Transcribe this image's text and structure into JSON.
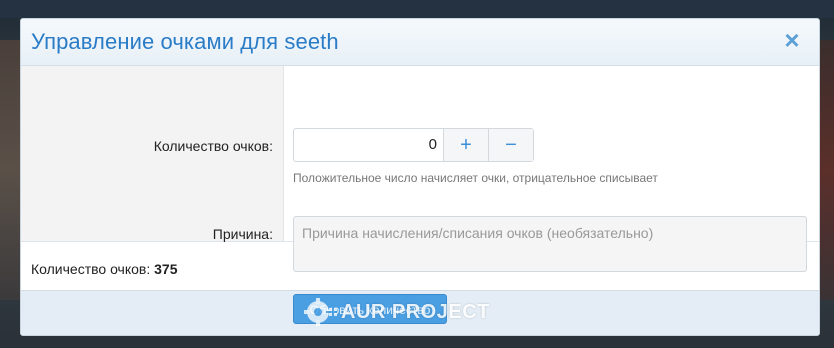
{
  "modal": {
    "title": "Управление очками для seeth",
    "close_symbol": "×"
  },
  "form": {
    "points_label": "Количество очков:",
    "points_value": "0",
    "plus_symbol": "+",
    "minus_symbol": "−",
    "points_hint": "Положительное число начисляет очки, отрицательное списывает",
    "reason_label": "Причина:",
    "reason_placeholder": "Причина начисления/списания очков (необязательно)"
  },
  "summary": {
    "label": "Количество очков:",
    "value": "375"
  },
  "footer": {
    "submit_label": "Обновить количество"
  },
  "watermark": {
    "text": "AUR PROJECT",
    "icon": "gear-plus-logo"
  },
  "colors": {
    "accent": "#2a7cc7",
    "button": "#4a9ee2"
  }
}
